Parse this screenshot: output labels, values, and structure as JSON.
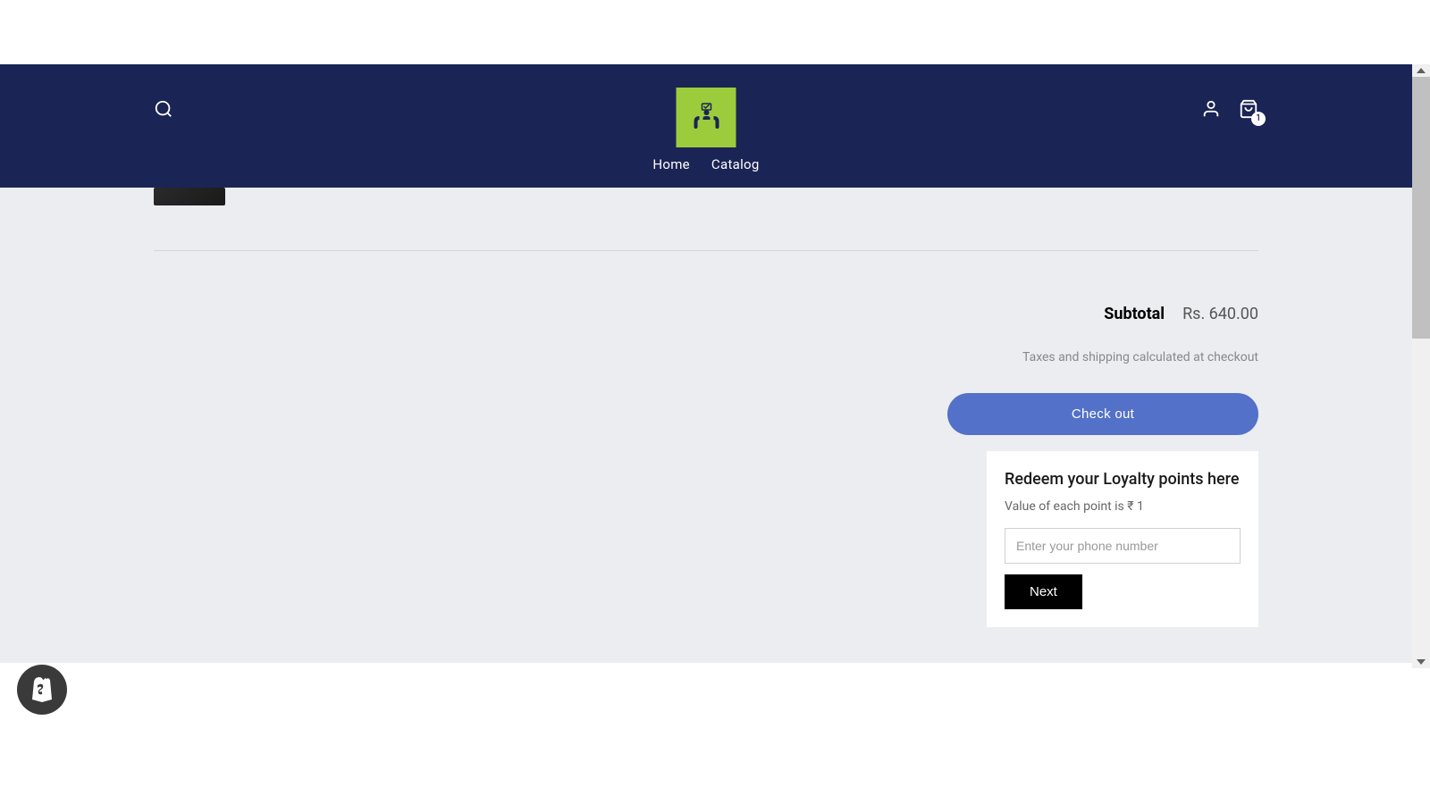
{
  "nav": {
    "home": "Home",
    "catalog": "Catalog"
  },
  "cart": {
    "badge_count": "1"
  },
  "subtotal": {
    "label": "Subtotal",
    "value": "Rs. 640.00"
  },
  "tax_note": "Taxes and shipping calculated at checkout",
  "checkout_label": "Check out",
  "loyalty": {
    "title": "Redeem your Loyalty points here",
    "subtitle": "Value of each point is ₹ 1",
    "phone_placeholder": "Enter your phone number",
    "next_label": "Next"
  }
}
